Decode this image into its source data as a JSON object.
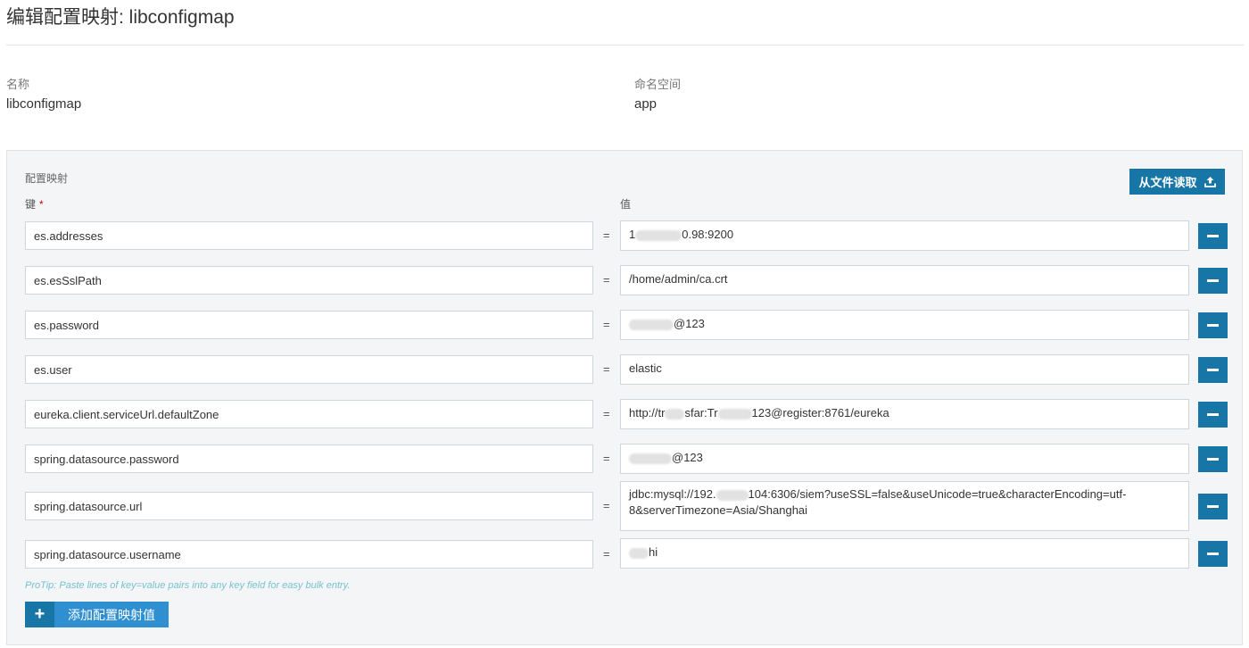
{
  "page": {
    "title": "编辑配置映射: libconfigmap"
  },
  "meta": {
    "name_label": "名称",
    "name_value": "libconfigmap",
    "namespace_label": "命名空间",
    "namespace_value": "app"
  },
  "configmap": {
    "section_label": "配置映射",
    "key_header": "键",
    "required_mark": "*",
    "value_header": "值",
    "read_file_label": "从文件读取",
    "equals": "=",
    "entries": [
      {
        "key": "es.addresses",
        "value_pre": "1",
        "value_post": "0.98:9200"
      },
      {
        "key": "es.esSslPath",
        "value_pre": "/home/admin/ca.crt",
        "value_post": ""
      },
      {
        "key": "es.password",
        "value_pre": "",
        "value_post": "@123"
      },
      {
        "key": "es.user",
        "value_pre": "elastic",
        "value_post": ""
      },
      {
        "key": "eureka.client.serviceUrl.defaultZone",
        "value_pre": "http://tr",
        "value_mid": "sfar:Tr",
        "value_post": "123@register:8761/eureka"
      },
      {
        "key": "spring.datasource.password",
        "value_pre": "",
        "value_post": "@123"
      },
      {
        "key": "spring.datasource.url",
        "value_pre": "jdbc:mysql://192.",
        "value_post": "104:6306/siem?useSSL=false&useUnicode=true&characterEncoding=utf-8&serverTimezone=Asia/Shanghai"
      },
      {
        "key": "spring.datasource.username",
        "value_pre": "",
        "value_post": "hi"
      }
    ],
    "protip": "ProTip: Paste lines of key=value pairs into any key field for easy bulk entry.",
    "add_label": "添加配置映射值",
    "add_icon": "+"
  },
  "colors": {
    "primary": "#1876a6",
    "add_button": "#2f8fd0",
    "protip": "#76c2cf"
  }
}
